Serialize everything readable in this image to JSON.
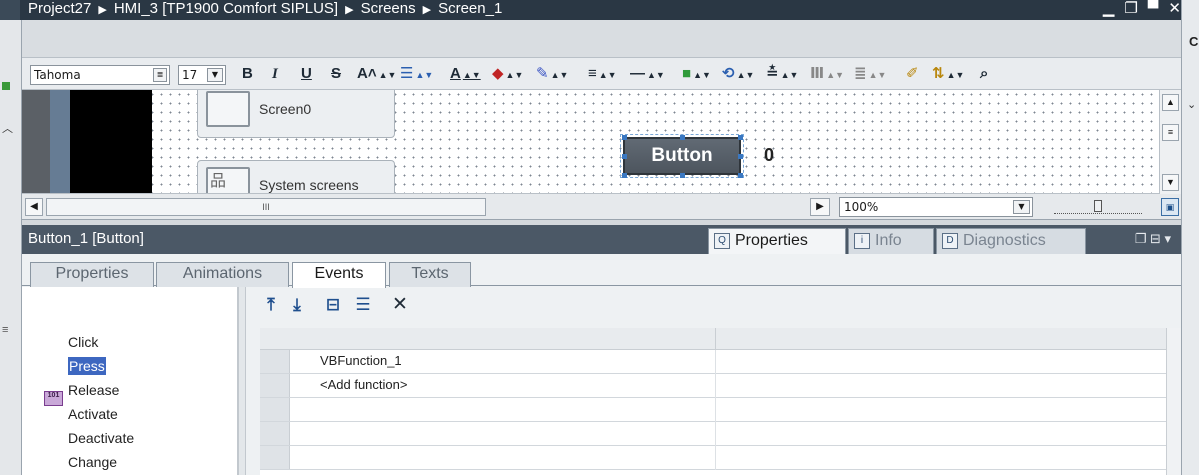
{
  "window": {
    "breadcrumb": [
      "Project27",
      "HMI_3 [TP1900 Comfort SIPLUS]",
      "Screens",
      "Screen_1"
    ],
    "controls": [
      "▁",
      "❐",
      "▀",
      "✕"
    ]
  },
  "right_strip": {
    "letter": "C",
    "chevron": "⌄"
  },
  "toolbar": {
    "font_name": "Tahoma",
    "font_size": "17",
    "bold": "B",
    "italic": "I",
    "underline": "U",
    "strike": "S",
    "text_size": "A˄",
    "font_color": "A"
  },
  "canvas": {
    "nav_tiles": [
      {
        "label": "Screen0"
      },
      {
        "label": "System screens"
      }
    ],
    "button_label": "Button",
    "io_value": "0"
  },
  "zoom": {
    "value": "100%"
  },
  "hscroll": {
    "grip": "III"
  },
  "inspector": {
    "title": "Button_1 [Button]",
    "tabs": [
      {
        "label": "Properties",
        "glyph": "Q",
        "active": true
      },
      {
        "label": "Info",
        "glyph": "i",
        "active": false
      },
      {
        "label": "Diagnostics",
        "glyph": "D",
        "active": false
      }
    ],
    "window_buttons": "❐ ⊟ ▾",
    "subtabs": [
      {
        "label": "Properties",
        "active": false
      },
      {
        "label": "Animations",
        "active": false
      },
      {
        "label": "Events",
        "active": true
      },
      {
        "label": "Texts",
        "active": false
      }
    ],
    "events": [
      {
        "label": "Click",
        "selected": false
      },
      {
        "label": "Press",
        "selected": true
      },
      {
        "label": "Release",
        "selected": false
      },
      {
        "label": "Activate",
        "selected": false
      },
      {
        "label": "Deactivate",
        "selected": false
      },
      {
        "label": "Change",
        "selected": false
      }
    ],
    "event_icon_text": "101",
    "functions": [
      {
        "name": "VBFunction_1"
      },
      {
        "name": "<Add function>"
      }
    ]
  }
}
